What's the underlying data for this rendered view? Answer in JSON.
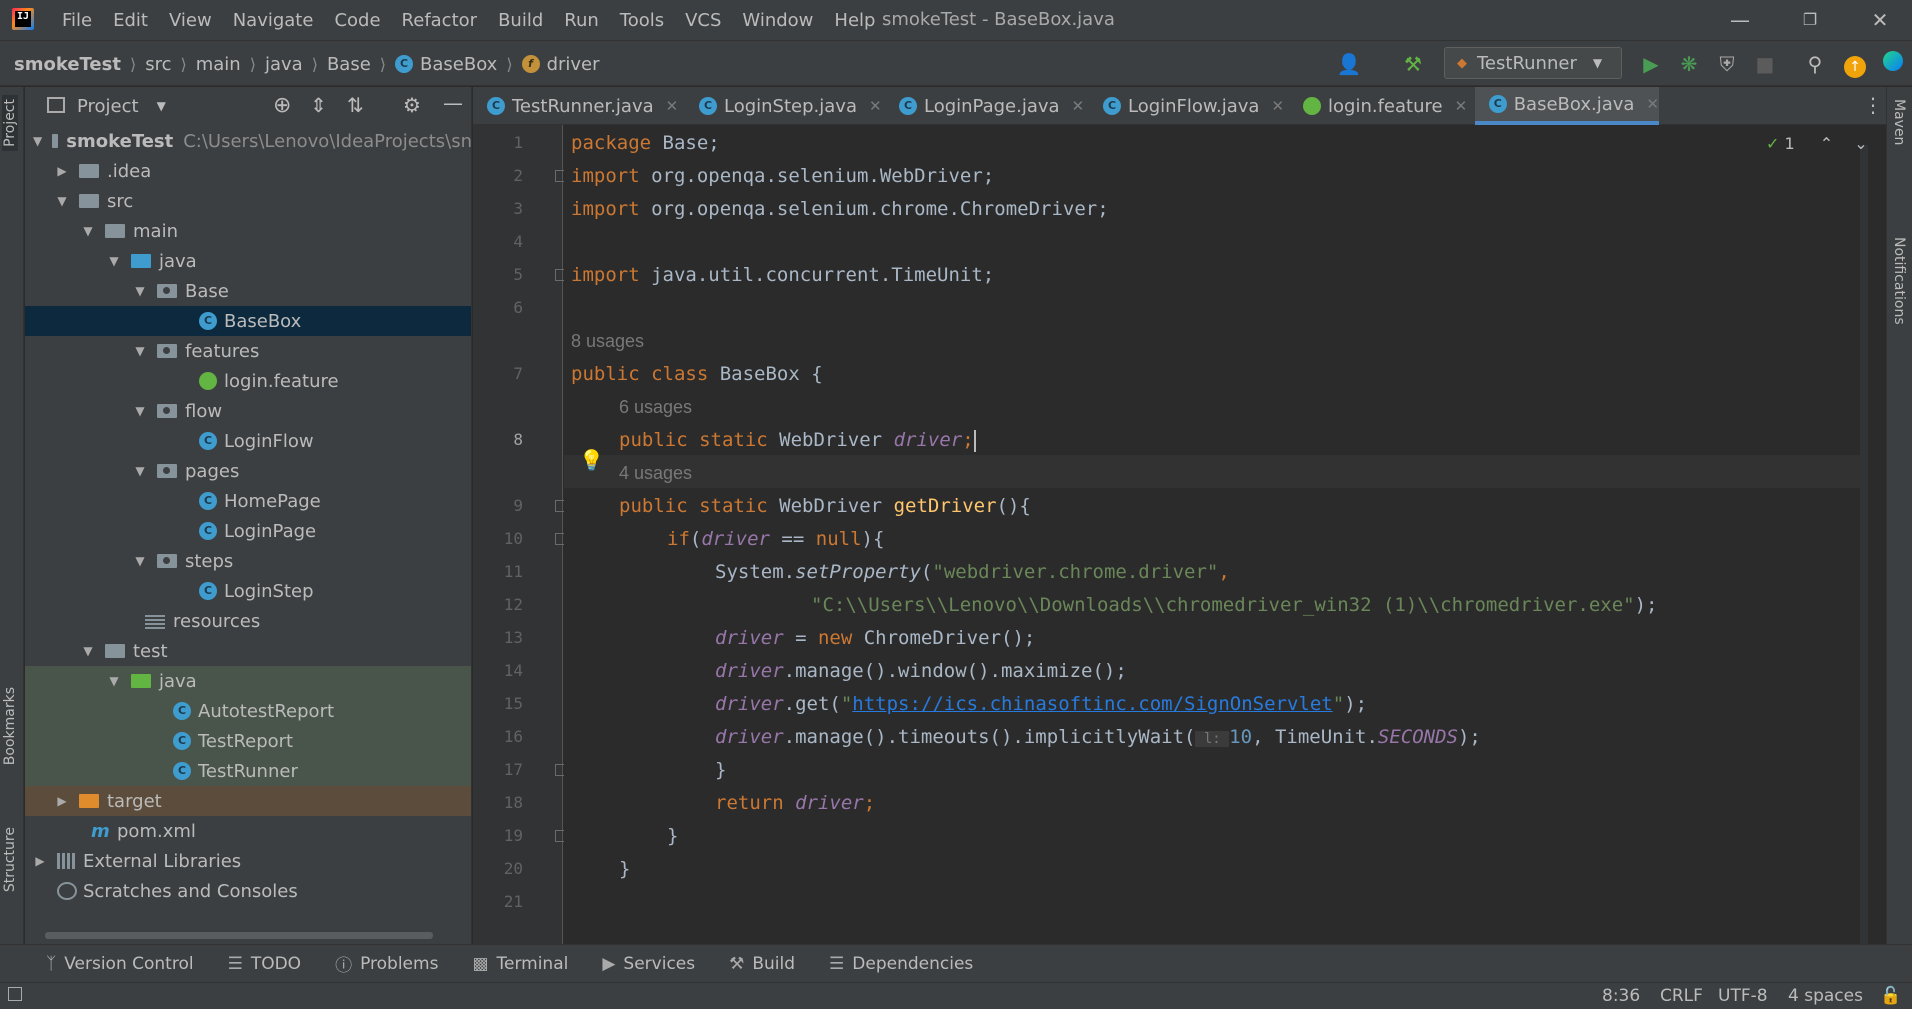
{
  "menubar": {
    "items": [
      "File",
      "Edit",
      "View",
      "Navigate",
      "Code",
      "Refactor",
      "Build",
      "Run",
      "Tools",
      "VCS",
      "Window",
      "Help"
    ],
    "window_title": "smokeTest - BaseBox.java"
  },
  "breadcrumbs": [
    "smokeTest",
    "src",
    "main",
    "java",
    "Base",
    "BaseBox",
    "driver"
  ],
  "run_config": "TestRunner",
  "left_tabs": [
    "Project",
    "Bookmarks",
    "Structure"
  ],
  "right_tabs": [
    "Maven",
    "Notifications"
  ],
  "project_panel": {
    "title": "Project",
    "root_label": "smokeTest",
    "root_path": "C:\\Users\\Lenovo\\IdeaProjects\\sn",
    "rows": [
      {
        "label": ".idea"
      },
      {
        "label": "src"
      },
      {
        "label": "main"
      },
      {
        "label": "java"
      },
      {
        "label": "Base"
      },
      {
        "label": "BaseBox"
      },
      {
        "label": "features"
      },
      {
        "label": "login.feature"
      },
      {
        "label": "flow"
      },
      {
        "label": "LoginFlow"
      },
      {
        "label": "pages"
      },
      {
        "label": "HomePage"
      },
      {
        "label": "LoginPage"
      },
      {
        "label": "steps"
      },
      {
        "label": "LoginStep"
      },
      {
        "label": "resources"
      },
      {
        "label": "test"
      },
      {
        "label": "java"
      },
      {
        "label": "AutotestReport"
      },
      {
        "label": "TestReport"
      },
      {
        "label": "TestRunner"
      },
      {
        "label": "target"
      },
      {
        "label": "pom.xml"
      },
      {
        "label": "External Libraries"
      },
      {
        "label": "Scratches and Consoles"
      }
    ]
  },
  "tabs": [
    "TestRunner.java",
    "LoginStep.java",
    "LoginPage.java",
    "LoginFlow.java",
    "login.feature",
    "BaseBox.java"
  ],
  "active_tab": "BaseBox.java",
  "editor": {
    "line_numbers": [
      "1",
      "2",
      "3",
      "4",
      "5",
      "6",
      "7",
      "8",
      "9",
      "10",
      "11",
      "12",
      "13",
      "14",
      "15",
      "16",
      "17",
      "18",
      "19",
      "20",
      "21"
    ],
    "usage_hints": [
      "8 usages",
      "6 usages",
      "4 usages"
    ],
    "inspection_count": "1",
    "code": {
      "l1_kw": "package",
      "l1_rest": " Base;",
      "l2_kw": "import",
      "l2_rest": " org.openqa.selenium.WebDriver;",
      "l3_kw": "import",
      "l3_rest": " org.openqa.selenium.chrome.ChromeDriver;",
      "l5_kw": "import",
      "l5_rest": " java.util.concurrent.TimeUnit;",
      "l7_kw": "public class",
      "l7_rest": " BaseBox {",
      "l8_kw": "public static",
      "l8_type": " WebDriver ",
      "l8_field": "driver",
      "l8_end": ";",
      "l9_kw": "public static",
      "l9_type": " WebDriver ",
      "l9_fn": "getDriver",
      "l9_end": "(){",
      "l10_kw": "if",
      "l10_a": "(",
      "l10_field": "driver",
      "l10_b": " == ",
      "l10_null": "null",
      "l10_c": "){",
      "l11_a": "System.",
      "l11_m": "setProperty",
      "l11_b": "(",
      "l11_s": "\"webdriver.chrome.driver\"",
      "l11_c": ",",
      "l12_s": "\"C:\\\\Users\\\\Lenovo\\\\Downloads\\\\chromedriver_win32 (1)\\\\chromedriver.exe\"",
      "l12_end": ");",
      "l13_field": "driver",
      "l13_a": " = ",
      "l13_kw": "new",
      "l13_b": " ChromeDriver();",
      "l14_field": "driver",
      "l14_a": ".manage().window().maximize();",
      "l15_field": "driver",
      "l15_a": ".get(",
      "l15_q1": "\"",
      "l15_url": "https://ics.chinasoftinc.com/SignOnServlet",
      "l15_q2": "\"",
      "l15_b": ");",
      "l16_field": "driver",
      "l16_a": ".manage().timeouts().implicitlyWait(",
      "l16_hint": " l: ",
      "l16_num": "10",
      "l16_b": ", TimeUnit.",
      "l16_const": "SECONDS",
      "l16_c": ");",
      "l17": "}",
      "l18_kw": "return",
      "l18_field": " driver",
      "l18_end": ";",
      "l19": "}",
      "l20": "}"
    }
  },
  "tool_windows": [
    "Version Control",
    "TODO",
    "Problems",
    "Terminal",
    "Services",
    "Build",
    "Dependencies"
  ],
  "status": {
    "position": "8:36",
    "line_sep": "CRLF",
    "encoding": "UTF-8",
    "indent": "4 spaces"
  },
  "colors": {
    "background": "#2b2b2b",
    "panel": "#3c3f41",
    "selection": "#0d293e",
    "accent": "#4a88c7",
    "keyword": "#cc7832",
    "string": "#6a8759",
    "field": "#9876aa"
  }
}
